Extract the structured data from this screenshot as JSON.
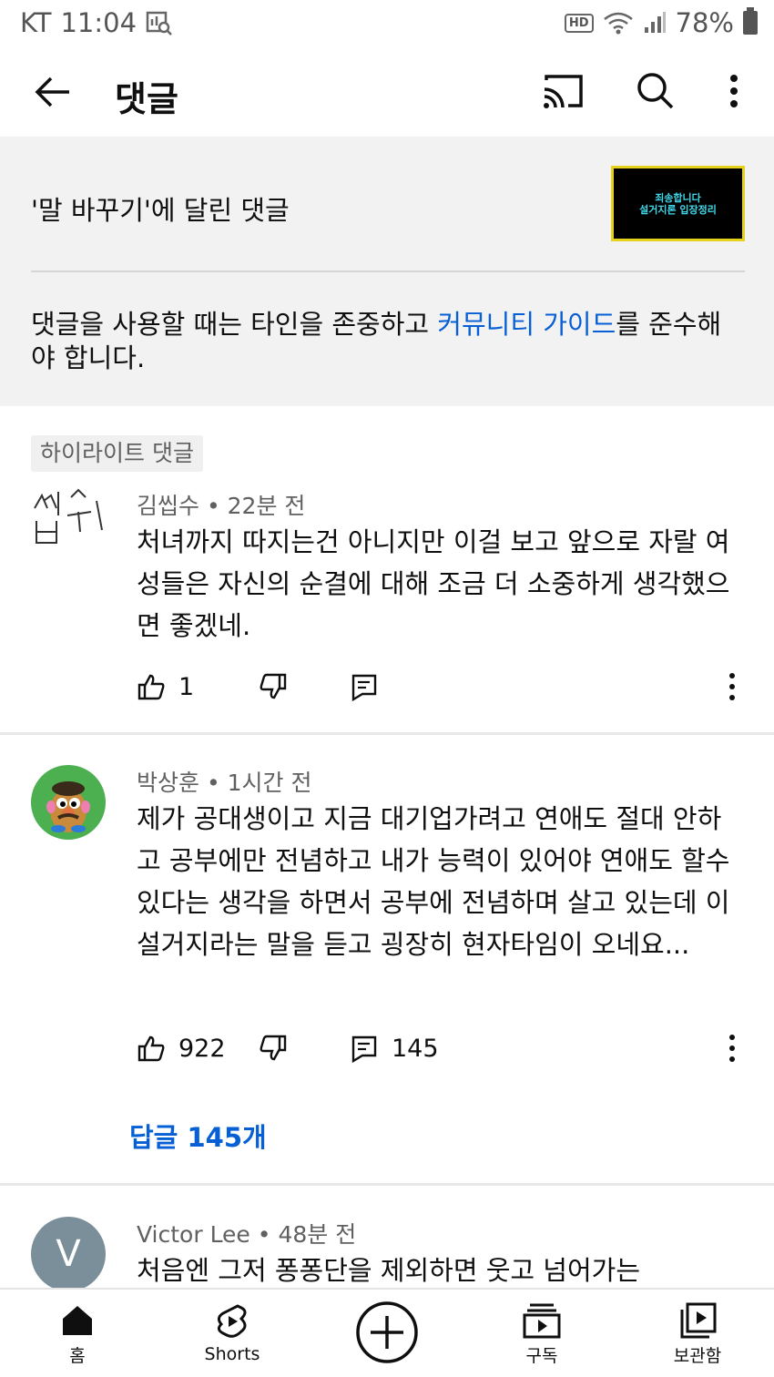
{
  "status": {
    "carrier": "KT",
    "time": "11:04",
    "battery": "78%",
    "hd": "HD"
  },
  "header": {
    "title": "댓글"
  },
  "video": {
    "title": "'말 바꾸기'에 달린 댓글",
    "thumb_line1": "죄송합니다",
    "thumb_line2": "설거지론 입장정리"
  },
  "guidelines": {
    "before": "댓글을 사용할 때는 타인을 존중하고 ",
    "link": "커뮤니티 가이드",
    "after": "를 준수해야 합니다."
  },
  "highlight_label": "하이라이트 댓글",
  "comments": [
    {
      "author": "김씹수",
      "time": "22분 전",
      "avatar_text": "씹수",
      "text": "처녀까지 따지는건 아니지만 이걸 보고 앞으로 자랄 여성들은 자신의 순결에 대해 조금 더 소중하게 생각했으면 좋겠네.",
      "likes": "1",
      "replies_count": ""
    },
    {
      "author": "박상훈",
      "time": "1시간 전",
      "text": "제가 공대생이고 지금 대기업가려고 연애도 절대 안하고 공부에만 전념하고 내가 능력이 있어야 연애도 할수 있다는 생각을 하면서 공부에 전념하며 살고 있는데 이 설거지라는 말을 듣고 굉장히 현자타임이 오네요...",
      "likes": "922",
      "replies_count": "145",
      "reply_link": "답글 145개"
    },
    {
      "author": "Victor Lee",
      "time": "48분 전",
      "avatar_text": "V",
      "text": "처음엔 그저 퐁퐁단을 제외하면 웃고 넘어가는"
    }
  ],
  "meta_separator": " • ",
  "nav": [
    {
      "label": "홈",
      "icon": "home-icon"
    },
    {
      "label": "Shorts",
      "icon": "shorts-icon"
    },
    {
      "label": "",
      "icon": "create-icon"
    },
    {
      "label": "구독",
      "icon": "subscriptions-icon"
    },
    {
      "label": "보관함",
      "icon": "library-icon"
    }
  ],
  "colors": {
    "link": "#065fd4",
    "panel_bg": "#f2f2f2",
    "avatar_v": "#7b8f9a"
  }
}
